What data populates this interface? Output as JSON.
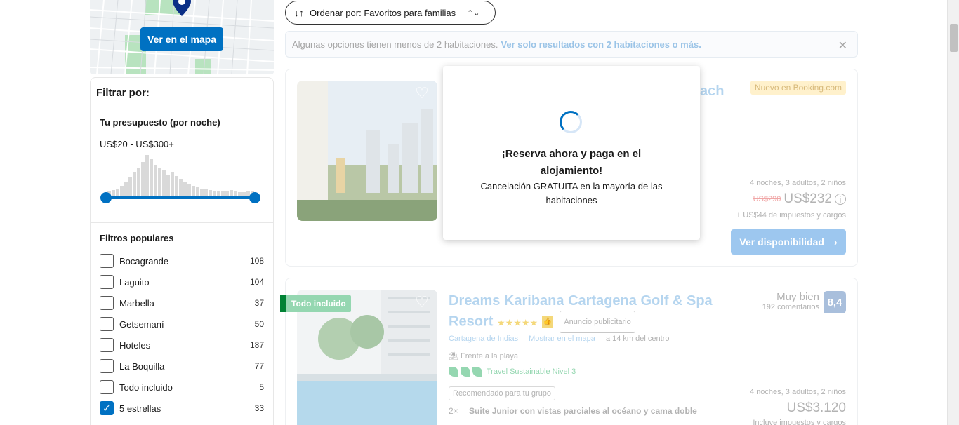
{
  "map": {
    "button_label": "Ver en el mapa"
  },
  "filters": {
    "heading": "Filtrar por:",
    "budget": {
      "title": "Tu presupuesto (por noche)",
      "range": "US$20 - US$300+"
    },
    "popular": {
      "title": "Filtros populares",
      "items": [
        {
          "label": "Bocagrande",
          "count": "108",
          "checked": false
        },
        {
          "label": "Laguito",
          "count": "104",
          "checked": false
        },
        {
          "label": "Marbella",
          "count": "37",
          "checked": false
        },
        {
          "label": "Getsemaní",
          "count": "50",
          "checked": false
        },
        {
          "label": "Hoteles",
          "count": "187",
          "checked": false
        },
        {
          "label": "La Boquilla",
          "count": "77",
          "checked": false
        },
        {
          "label": "Todo incluido",
          "count": "5",
          "checked": false
        },
        {
          "label": "5 estrellas",
          "count": "33",
          "checked": true
        }
      ]
    }
  },
  "sort": {
    "label": "Ordenar por: Favoritos para familias"
  },
  "notice": {
    "text": "Algunas opciones tienen menos de 2 habitaciones.",
    "link": "Ver solo resultados con 2 habitaciones o más."
  },
  "card1": {
    "badge": "Nuevo en Booking.com",
    "title_fragment": "ach",
    "meta": "4 noches, 3 adultos, 2 niños",
    "old_price": "US$290",
    "price": "US$232",
    "tax": "+ US$44 de impuestos y cargos",
    "button": "Ver disponibilidad"
  },
  "card2": {
    "ribbon": "Todo incluido",
    "name": "Dreams Karibana Cartagena Golf & Spa Resort",
    "ad_label": "Anuncio publicitario",
    "location_link": "Cartagena de Indias",
    "map_link": "Mostrar en el mapa",
    "distance": "a 14 km del centro",
    "beach": "Frente a la playa",
    "sustainable": "Travel Sustainable Nivel 3",
    "recommended": "Recomendado para tu grupo",
    "room_qty": "2×",
    "room": "Suite Junior con vistas parciales al océano y cama doble",
    "score_text": "Muy bien",
    "reviews": "192 comentarios",
    "score": "8,4",
    "meta": "4 noches, 3 adultos, 2 niños",
    "price": "US$3.120",
    "tax": "Incluye impuestos y cargos"
  },
  "modal": {
    "heading": "¡Reserva ahora y paga en el alojamiento!",
    "text": "Cancelación GRATUITA en la mayoría de las habitaciones"
  },
  "colors": {
    "accent": "#0071c2",
    "green": "#008234"
  }
}
